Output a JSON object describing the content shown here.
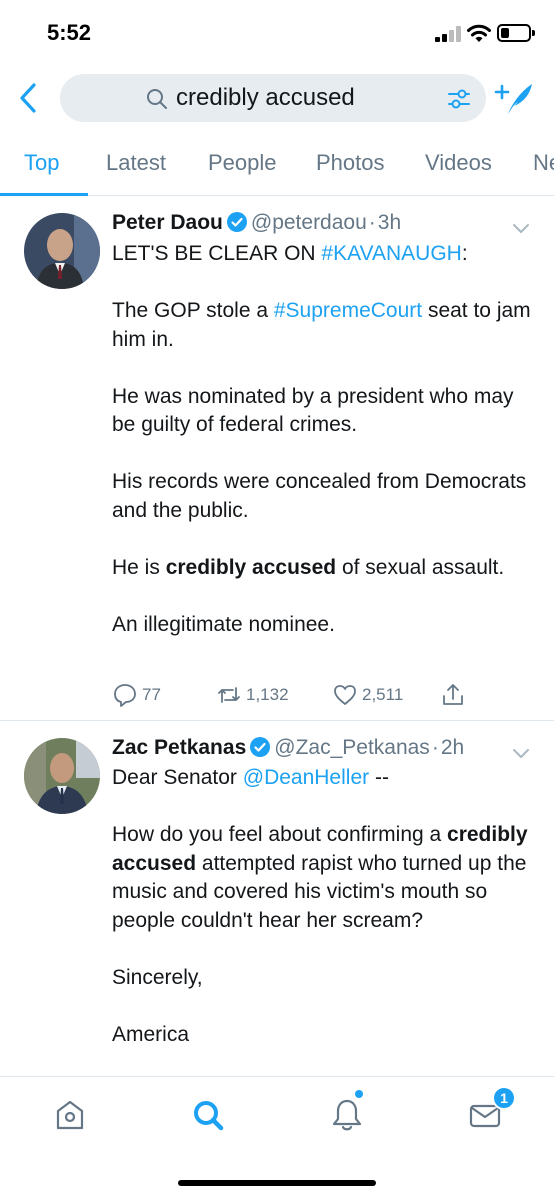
{
  "status_bar": {
    "time": "5:52"
  },
  "search": {
    "query": "credibly accused"
  },
  "tabs": [
    {
      "label": "Top",
      "active": true
    },
    {
      "label": "Latest",
      "active": false
    },
    {
      "label": "People",
      "active": false
    },
    {
      "label": "Photos",
      "active": false
    },
    {
      "label": "Videos",
      "active": false
    },
    {
      "label": "Ne",
      "active": false
    }
  ],
  "tweets": [
    {
      "display_name": "Peter Daou",
      "handle": "@peterdaou",
      "separator": "·",
      "time": "3h",
      "body": {
        "l1_pre": "LET'S BE CLEAR ON ",
        "l1_link": "#KAVANAUGH",
        "l1_post": ":",
        "p2_pre": "The GOP stole a ",
        "p2_link": "#SupremeCourt",
        "p2_post": " seat to jam him in.",
        "p3": "He was nominated by a president who may be guilty of federal crimes.",
        "p4": "His records were concealed from Democrats and the public.",
        "p5_pre": "He is ",
        "p5_bold": "credibly accused",
        "p5_post": " of sexual assault.",
        "p6": "An illegitimate nominee."
      },
      "stats": {
        "replies": "77",
        "retweets": "1,132",
        "likes": "2,511"
      }
    },
    {
      "display_name": "Zac Petkanas",
      "handle": "@Zac_Petkanas",
      "separator": "·",
      "time": "2h",
      "body": {
        "l1_pre": "Dear Senator ",
        "l1_link": "@DeanHeller",
        "l1_post": " --",
        "p2_pre": "How do you feel about confirming a ",
        "p2_bold": "credibly accused",
        "p2_post": " attempted rapist who turned up the music and covered his victim's mouth so people couldn't hear her scream?",
        "p3": "Sincerely,",
        "p4": "America"
      }
    }
  ],
  "tabbar": {
    "messages_badge": "1"
  },
  "colors": {
    "accent": "#1da1f2",
    "secondary_text": "#657786",
    "search_bg": "#e6ecf0"
  }
}
